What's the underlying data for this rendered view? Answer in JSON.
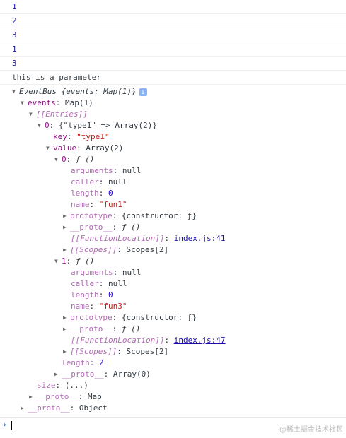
{
  "logs": [
    "1",
    "2",
    "3",
    "1",
    "3"
  ],
  "message": "this is a parameter",
  "tree": {
    "root_name": "EventBus",
    "root_preview": " {events: Map(1)}",
    "info_icon_label": "i",
    "events_key": "events",
    "events_val": "Map(1)",
    "entries_key": "[[Entries]]",
    "entry0_key": "0",
    "entry0_val": "{\"type1\" => Array(2)}",
    "key_label": "key",
    "key_val": "\"type1\"",
    "value_label": "value",
    "value_val": "Array(2)",
    "fn0_key": "0",
    "fn0_val": "ƒ ()",
    "fn0_props": [
      {
        "k": "arguments",
        "v": "null"
      },
      {
        "k": "caller",
        "v": "null"
      },
      {
        "k": "length",
        "v": "0"
      },
      {
        "k": "name",
        "v": "\"fun1\""
      }
    ],
    "fn0_prototype": "{constructor: ƒ}",
    "fn0_proto": "ƒ ()",
    "fn0_location": "index.js:41",
    "fn0_scopes": "Scopes[2]",
    "fn1_key": "1",
    "fn1_val": "ƒ ()",
    "fn1_props": [
      {
        "k": "arguments",
        "v": "null"
      },
      {
        "k": "caller",
        "v": "null"
      },
      {
        "k": "length",
        "v": "0"
      },
      {
        "k": "name",
        "v": "\"fun3\""
      }
    ],
    "fn1_prototype": "{constructor: ƒ}",
    "fn1_proto": "ƒ ()",
    "fn1_location": "index.js:47",
    "fn1_scopes": "Scopes[2]",
    "prototype_label": "prototype",
    "proto_label": "__proto__",
    "function_location_label": "[[FunctionLocation]]",
    "scopes_label": "[[Scopes]]",
    "array_length_label": "length",
    "array_length_val": "2",
    "array_proto_val": "Array(0)",
    "size_label": "size",
    "size_val": "(...)",
    "map_proto_val": "Map",
    "object_proto_val": "Object"
  },
  "prompt_symbol": "›",
  "watermark": "@稀土掘金技术社区"
}
